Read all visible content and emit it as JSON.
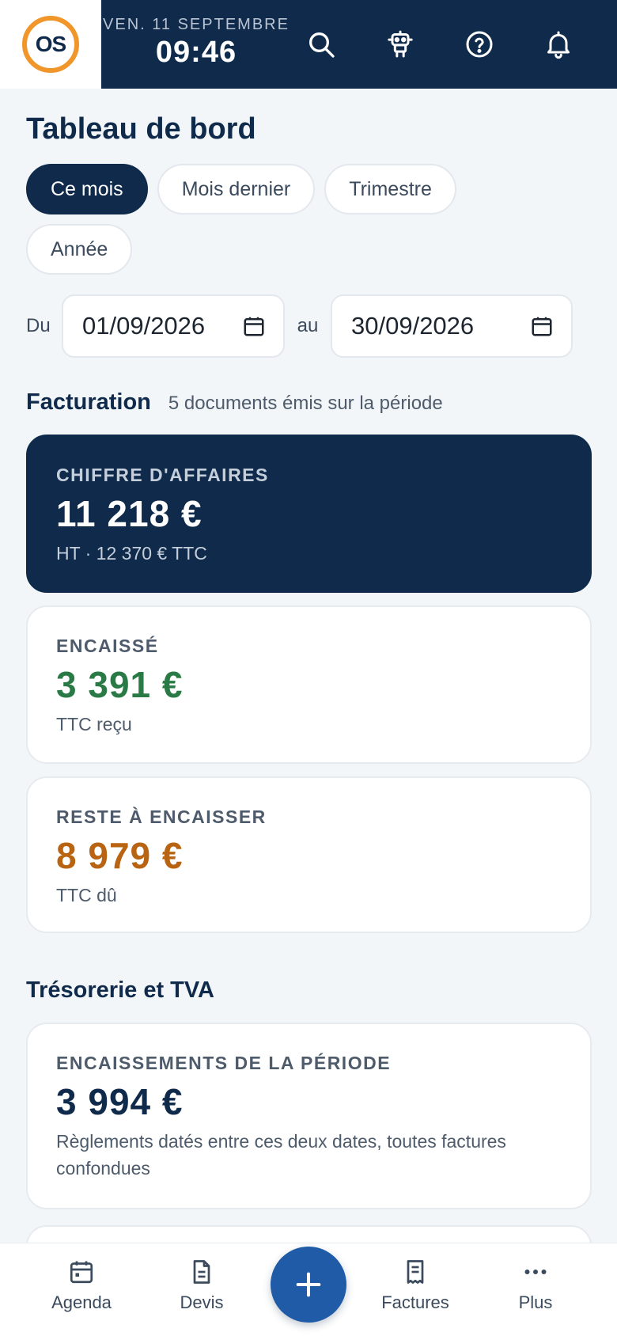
{
  "header": {
    "logo_text": "OS",
    "date": "VEN. 11 SEPTEMBRE",
    "time": "09:46"
  },
  "page": {
    "title": "Tableau de bord"
  },
  "period_filters": [
    {
      "label": "Ce mois",
      "active": true
    },
    {
      "label": "Mois dernier",
      "active": false
    },
    {
      "label": "Trimestre",
      "active": false
    },
    {
      "label": "Année",
      "active": false
    }
  ],
  "range": {
    "from_label": "Du",
    "from_value": "01/09/2026",
    "to_label": "au",
    "to_value": "30/09/2026"
  },
  "billing": {
    "title": "Facturation",
    "subtitle": "5 documents émis sur la période",
    "revenue": {
      "label": "CHIFFRE D'AFFAIRES",
      "value": "11 218 €",
      "note": "HT · 12 370 € TTC"
    },
    "collected": {
      "label": "ENCAISSÉ",
      "value": "3 391 €",
      "note": "TTC reçu",
      "color": "#2a7a45"
    },
    "outstanding": {
      "label": "RESTE À ENCAISSER",
      "value": "8 979 €",
      "note": "TTC dû",
      "color": "#b86412"
    }
  },
  "treasury": {
    "title": "Trésorerie et TVA",
    "receipts": {
      "label": "ENCAISSEMENTS DE LA PÉRIODE",
      "value": "3 994 €",
      "note": "Règlements datés entre ces deux dates, toutes factures confondues",
      "color": "#0f2a4a"
    }
  },
  "bottom_nav": {
    "agenda": "Agenda",
    "quotes": "Devis",
    "invoices": "Factures",
    "more": "Plus"
  },
  "colors": {
    "navy": "#0f2a4a",
    "accent_orange": "#f0962a",
    "fab_blue": "#1f5ba6"
  },
  "icons": [
    "search-icon",
    "robot-icon",
    "help-icon",
    "bell-icon",
    "calendar-icon",
    "document-icon",
    "plus-icon",
    "receipt-icon",
    "more-icon"
  ]
}
